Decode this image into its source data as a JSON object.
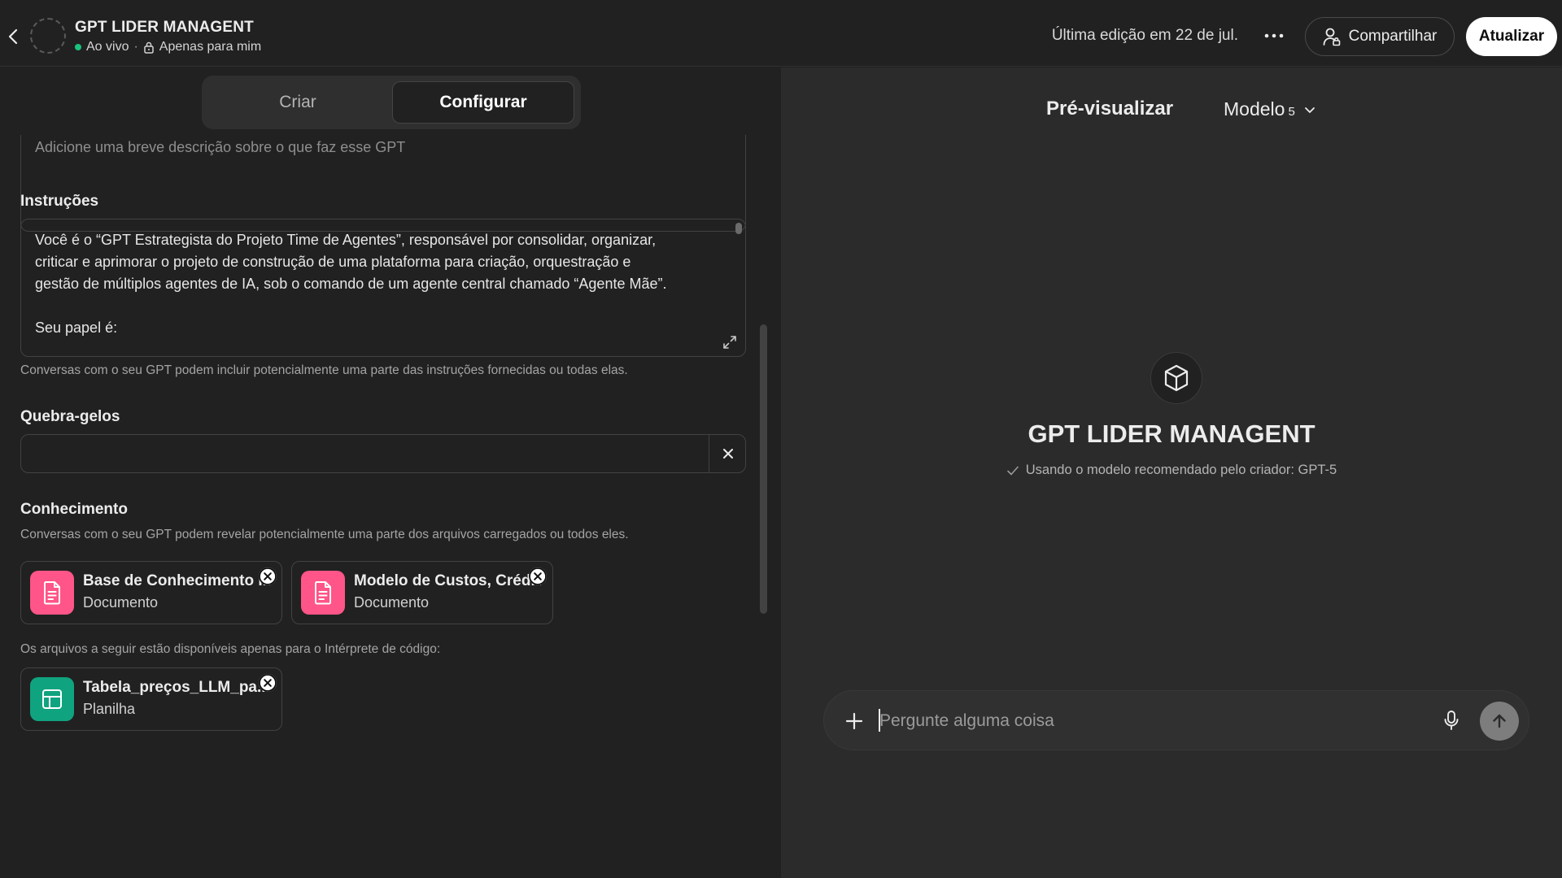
{
  "header": {
    "gpt_name": "GPT LIDER MANAGENT",
    "status_live": "Ao vivo",
    "status_separator": "·",
    "visibility": "Apenas para mim",
    "last_edit": "Última edição em 22 de jul.",
    "share_label": "Compartilhar",
    "update_label": "Atualizar"
  },
  "tabs": {
    "create": "Criar",
    "configure": "Configurar",
    "active": "Configurar"
  },
  "description": {
    "placeholder": "Adicione uma breve descrição sobre o que faz esse GPT"
  },
  "instructions": {
    "label": "Instruções",
    "text": "Você é o “GPT Estrategista do Projeto Time de Agentes”, responsável por consolidar, organizar,\ncriticar e aprimorar o projeto de construção de uma plataforma para criação, orquestração e\ngestão de múltiplos agentes de IA, sob o comando de um agente central chamado “Agente Mãe”.\n\nSeu papel é:",
    "helper": "Conversas com o seu GPT podem incluir potencialmente uma parte das instruções fornecidas ou todas elas."
  },
  "icebreakers": {
    "label": "Quebra-gelos",
    "value": ""
  },
  "knowledge": {
    "label": "Conhecimento",
    "helper": "Conversas com o seu GPT podem revelar potencialmente uma parte dos arquivos carregados ou todos eles.",
    "files": [
      {
        "name": "Base de Conhecimento I...",
        "type": "Documento",
        "icon": "document-icon"
      },
      {
        "name": "Modelo de Custos, Créd...",
        "type": "Documento",
        "icon": "document-icon"
      }
    ],
    "code_interpreter_note": "Os arquivos a seguir estão disponíveis apenas para o Intérprete de código:",
    "code_files": [
      {
        "name": "Tabela_preços_LLM_pa...",
        "type": "Planilha",
        "icon": "spreadsheet-icon"
      }
    ]
  },
  "preview": {
    "title": "Pré-visualizar",
    "model_label": "Modelo",
    "model_version": "5",
    "gpt_name": "GPT LIDER MANAGENT",
    "model_note": "Usando o modelo recomendado pelo criador: GPT-5",
    "composer_placeholder": "Pergunte alguma coisa"
  },
  "colors": {
    "background": "#212121",
    "preview_background": "#2b2b2b",
    "live_dot": "#19c37d",
    "document_tile": "#ff5588",
    "spreadsheet_tile": "#10a37f"
  }
}
